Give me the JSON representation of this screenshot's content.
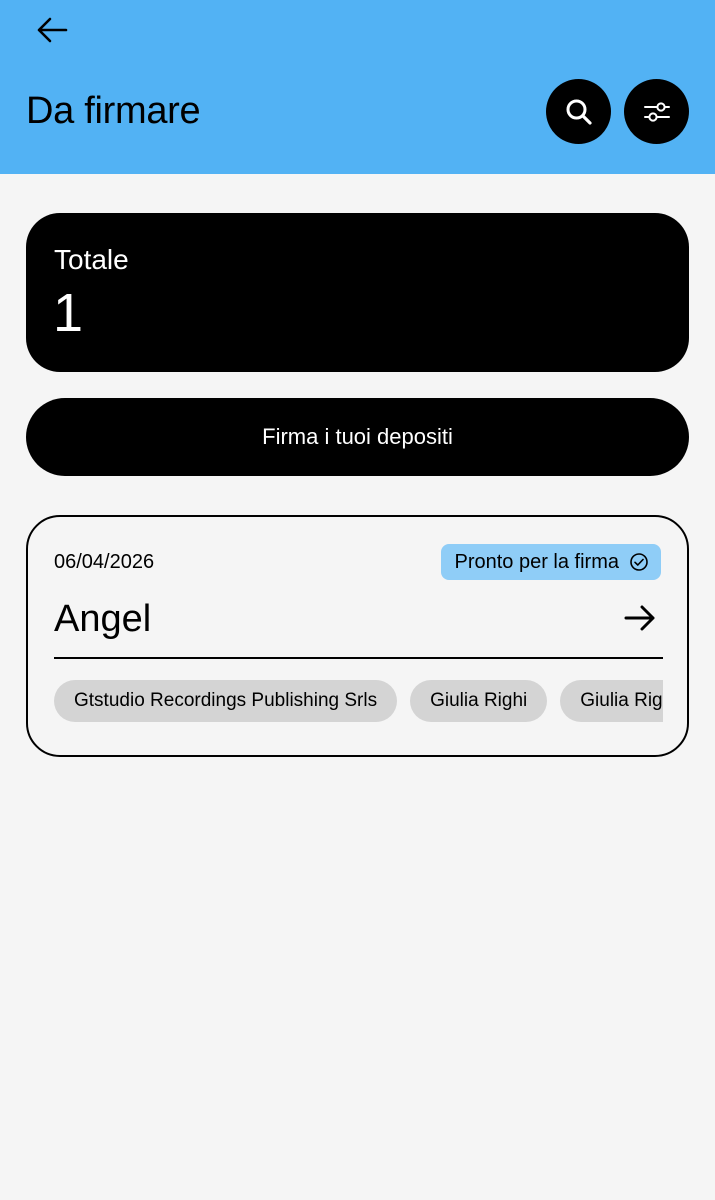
{
  "header": {
    "title": "Da firmare",
    "back_icon": "arrow-left-icon",
    "search_icon": "search-icon",
    "filter_icon": "sliders-icon",
    "background": "#52b2f4"
  },
  "summary": {
    "label": "Totale",
    "count": "1"
  },
  "actions": {
    "sign_label": "Firma i tuoi depositi"
  },
  "deposits": [
    {
      "date": "06/04/2026",
      "status": "Pronto per la firma",
      "status_icon": "check-circle-icon",
      "status_color": "#8fcdf7",
      "name": "Angel",
      "parties": [
        "Gtstudio Recordings Publishing Srls",
        "Giulia Righi",
        "Giulia Righi"
      ]
    }
  ]
}
